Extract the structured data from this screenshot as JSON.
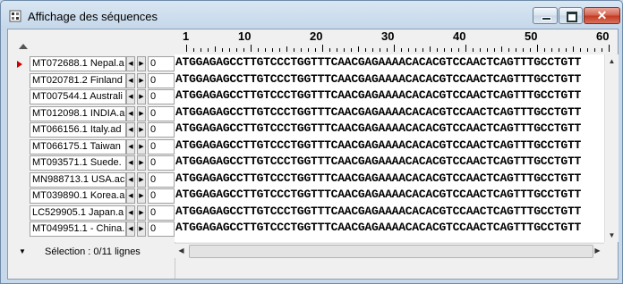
{
  "window": {
    "title": "Affichage des séquences",
    "close_label": "✕"
  },
  "ruler": {
    "labels": [
      "1",
      "10",
      "20",
      "30",
      "40",
      "50",
      "60"
    ]
  },
  "rows": [
    {
      "name": "MT072688.1 Nepal.a",
      "offset": "0",
      "sequence": "ATGGAGAGCCTTGTCCCTGGTTTCAACGAGAAAACACACGTCCAACTCAGTTTGCCTGTT"
    },
    {
      "name": "MT020781.2 Finland",
      "offset": "0",
      "sequence": "ATGGAGAGCCTTGTCCCTGGTTTCAACGAGAAAACACACGTCCAACTCAGTTTGCCTGTT"
    },
    {
      "name": "MT007544.1 Australi",
      "offset": "0",
      "sequence": "ATGGAGAGCCTTGTCCCTGGTTTCAACGAGAAAACACACGTCCAACTCAGTTTGCCTGTT"
    },
    {
      "name": "MT012098.1 INDIA.a",
      "offset": "0",
      "sequence": "ATGGAGAGCCTTGTCCCTGGTTTCAACGAGAAAACACACGTCCAACTCAGTTTGCCTGTT"
    },
    {
      "name": "MT066156.1 Italy.ad",
      "offset": "0",
      "sequence": "ATGGAGAGCCTTGTCCCTGGTTTCAACGAGAAAACACACGTCCAACTCAGTTTGCCTGTT"
    },
    {
      "name": "MT066175.1 Taiwan",
      "offset": "0",
      "sequence": "ATGGAGAGCCTTGTCCCTGGTTTCAACGAGAAAACACACGTCCAACTCAGTTTGCCTGTT"
    },
    {
      "name": "MT093571.1 Suede.",
      "offset": "0",
      "sequence": "ATGGAGAGCCTTGTCCCTGGTTTCAACGAGAAAACACACGTCCAACTCAGTTTGCCTGTT"
    },
    {
      "name": "MN988713.1 USA.ac",
      "offset": "0",
      "sequence": "ATGGAGAGCCTTGTCCCTGGTTTCAACGAGAAAACACACGTCCAACTCAGTTTGCCTGTT"
    },
    {
      "name": "MT039890.1 Korea.a",
      "offset": "0",
      "sequence": "ATGGAGAGCCTTGTCCCTGGTTTCAACGAGAAAACACACGTCCAACTCAGTTTGCCTGTT"
    },
    {
      "name": "LC529905.1 Japan.a",
      "offset": "0",
      "sequence": "ATGGAGAGCCTTGTCCCTGGTTTCAACGAGAAAACACACGTCCAACTCAGTTTGCCTGTT"
    },
    {
      "name": "MT049951.1 - China.",
      "offset": "0",
      "sequence": "ATGGAGAGCCTTGTCCCTGGTTTCAACGAGAAAACACACGTCCAACTCAGTTTGCCTGTT"
    }
  ],
  "status": {
    "selection": "Sélection : 0/11 lignes"
  },
  "colors": {
    "current_row_marker": "#cc0000"
  }
}
